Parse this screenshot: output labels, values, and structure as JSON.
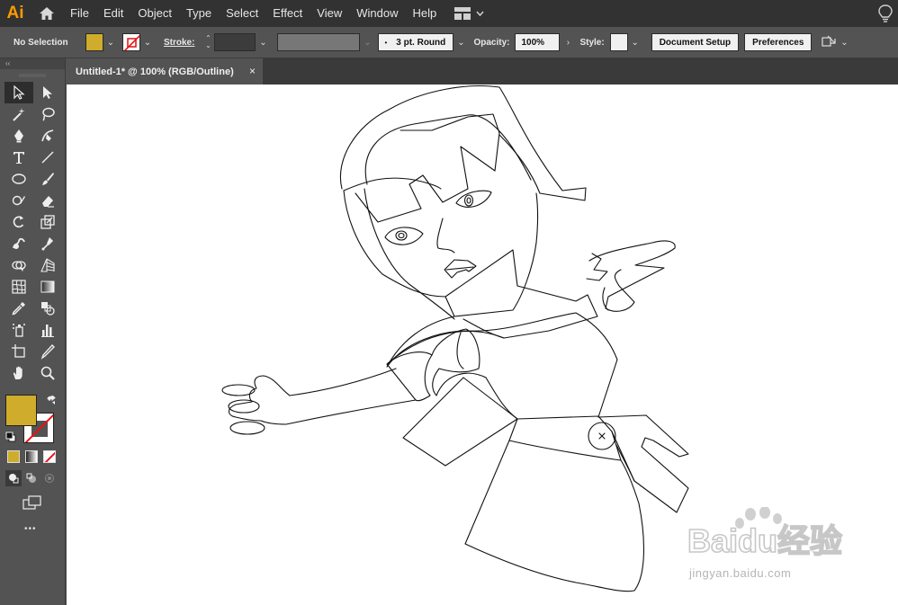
{
  "app": {
    "logo_text": "Ai",
    "accent_color": "#ff9a00"
  },
  "menu": {
    "items": [
      "File",
      "Edit",
      "Object",
      "Type",
      "Select",
      "Effect",
      "View",
      "Window",
      "Help"
    ]
  },
  "control_bar": {
    "selection_label": "No Selection",
    "fill_color": "#cfac2b",
    "stroke_label": "Stroke:",
    "brush_label": "3 pt. Round",
    "opacity_label": "Opacity:",
    "opacity_value": "100%",
    "style_label": "Style:",
    "document_setup_button": "Document Setup",
    "preferences_button": "Preferences"
  },
  "document_tab": {
    "title": "Untitled-1* @ 100% (RGB/Outline)",
    "close_glyph": "×"
  },
  "toolbox": {
    "collapse_glyph": "‹‹",
    "more_glyph": "•••",
    "fill_color": "#cfac2b"
  },
  "watermark": {
    "brand": "Baidu经验",
    "url": "jingyan.baidu.com"
  }
}
